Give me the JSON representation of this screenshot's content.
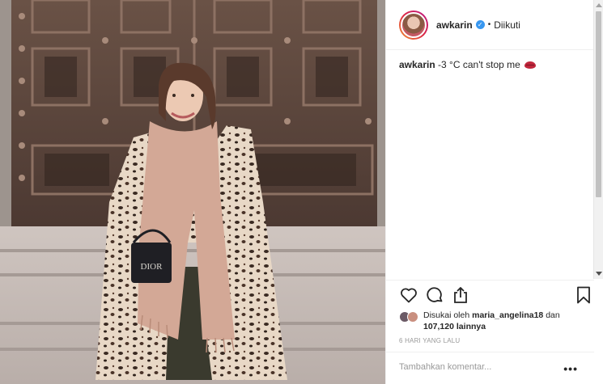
{
  "post": {
    "username": "awkarin",
    "verified_glyph": "✓",
    "separator": "•",
    "follow_status": "Diikuti",
    "caption_text": "-3 °C can't stop me",
    "caption_emoji": "lips-icon"
  },
  "photo": {
    "bag_logo": "DIOR",
    "subject": "woman-in-leopard-coat-and-scarf-before-bronze-door"
  },
  "actions": {
    "icons": [
      "heart-icon",
      "comment-icon",
      "share-icon",
      "bookmark-icon"
    ],
    "likes_prefix": "Disukai oleh",
    "liked_by_user": "maria_angelina18",
    "likes_and": "dan",
    "likes_count": "107,120",
    "likes_suffix": "lainnya",
    "timestamp": "6 HARI YANG LALU"
  },
  "comment": {
    "placeholder": "Tambahkan komentar...",
    "more_label": "•••"
  },
  "colors": {
    "verified": "#3897f0",
    "border": "#efefef",
    "muted": "#999999"
  }
}
